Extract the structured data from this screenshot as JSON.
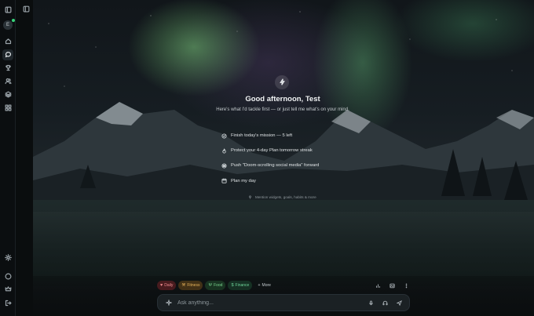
{
  "sidebar": {
    "avatar_initial": "E",
    "items": [
      {
        "name": "home",
        "icon": "home-icon"
      },
      {
        "name": "chat",
        "icon": "chat-icon",
        "active": true
      },
      {
        "name": "trophy",
        "icon": "trophy-icon"
      },
      {
        "name": "people",
        "icon": "people-icon"
      },
      {
        "name": "layers",
        "icon": "layers-icon"
      },
      {
        "name": "apps",
        "icon": "grid-icon"
      }
    ],
    "bottom_items": [
      {
        "name": "settings",
        "icon": "gear-icon"
      },
      {
        "name": "profile",
        "icon": "user-circle-icon"
      },
      {
        "name": "crown",
        "icon": "crown-icon"
      },
      {
        "name": "logout",
        "icon": "logout-icon"
      }
    ],
    "status_color": "#37d27a"
  },
  "main": {
    "greeting": "Good afternoon, Test",
    "subtitle": "Here's what I'd tackle first — or just tell me what's on your mind.",
    "suggestions": [
      {
        "label": "Finish today's mission — 5 left",
        "icon": "target-icon"
      },
      {
        "label": "Protect your 4-day Plan tomorrow streak",
        "icon": "flame-icon"
      },
      {
        "label": "Push \"Doom-scrolling social media\" forward",
        "icon": "push-icon"
      },
      {
        "label": "Plan my day",
        "icon": "calendar-icon"
      }
    ],
    "mention_hint": "Mention widgets, goals, habits & more"
  },
  "chips": [
    {
      "label": "Daily",
      "icon": "heart-icon",
      "color": "#f18b8f"
    },
    {
      "label": "Fitness",
      "icon": "dumbbell-icon",
      "color": "#e7b25b"
    },
    {
      "label": "Food",
      "icon": "fork-knife-icon",
      "color": "#7bd590"
    },
    {
      "label": "Finance",
      "icon": "dollar-icon",
      "color": "#6fd39a"
    },
    {
      "label": "More",
      "icon": "plus-icon"
    }
  ],
  "composer": {
    "placeholder": "Ask anything..."
  }
}
